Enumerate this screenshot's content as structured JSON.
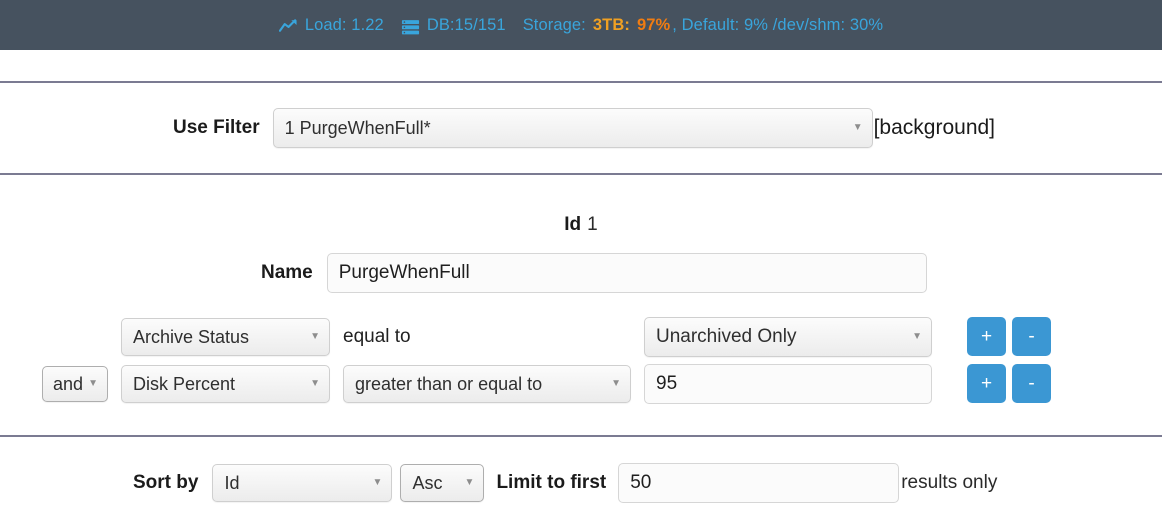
{
  "statusbar": {
    "load_icon": "trending-up-icon",
    "load_label": "Load: 1.22",
    "db_icon": "database-stack-icon",
    "db_label": "DB:15/151",
    "storage_label": "Storage:",
    "storage_size": "3TB:",
    "storage_percent": "97%",
    "storage_tail": ", Default: 9% /dev/shm: 30%",
    "color_blue": "#39a5dc",
    "color_amber": "#f0a022",
    "color_orange": "#f07c12",
    "background": "#46525f"
  },
  "use_filter": {
    "label": "Use Filter",
    "selected": "1 PurgeWhenFull*",
    "background_note": "[background]",
    "caret": "▼"
  },
  "detail": {
    "id_label": "Id",
    "id_value": "1",
    "name_label": "Name",
    "name_value": "PurgeWhenFull"
  },
  "conditions": [
    {
      "conjunction": null,
      "field": "Archive Status",
      "operator": "equal to",
      "operator_is_select": false,
      "value": "Unarchived Only",
      "value_is_select": true,
      "add_label": "+",
      "remove_label": "-"
    },
    {
      "conjunction": "and",
      "field": "Disk Percent",
      "operator": "greater than or equal to",
      "operator_is_select": true,
      "value": "95",
      "value_is_select": false,
      "add_label": "+",
      "remove_label": "-"
    }
  ],
  "sort": {
    "sort_by_label": "Sort by",
    "sort_field": "Id",
    "sort_direction": "Asc",
    "limit_label": "Limit to first",
    "limit_value": "50",
    "results_label": "results only"
  },
  "theme": {
    "button_blue": "#3b97d3",
    "divider": "#7b7b92"
  }
}
